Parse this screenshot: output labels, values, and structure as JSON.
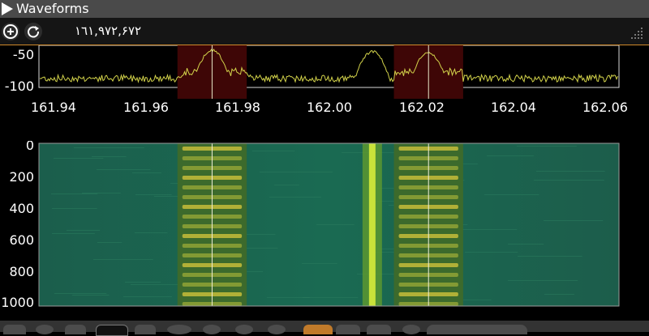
{
  "window": {
    "title": "Waveforms"
  },
  "toolbar": {
    "frequency": "١٦١,٩٧٢,۶٧٢",
    "zoom_in_icon": "zoom-in-icon",
    "redo_icon": "redo-icon"
  },
  "spectrum": {
    "y_tick_labels": [
      "-50",
      "-100"
    ],
    "x_tick_labels": [
      "161.94",
      "161.96",
      "161.98",
      "162.00",
      "162.02",
      "162.04",
      "162.06"
    ],
    "trace_color": "#d2d24a"
  },
  "waterfall": {
    "y_tick_labels": [
      "0",
      "200",
      "400",
      "600",
      "800",
      "1000"
    ]
  },
  "chart_data": {
    "type": "line",
    "x_range": [
      161.933,
      162.067
    ],
    "ylim": [
      -105,
      -45
    ],
    "markers": [
      161.973,
      162.023
    ],
    "highlight_bands": [
      [
        161.965,
        161.981
      ],
      [
        162.015,
        162.031
      ]
    ],
    "noise_floor": -92,
    "peaks": [
      {
        "x": 161.973,
        "y": -50
      },
      {
        "x": 162.01,
        "y": -52
      },
      {
        "x": 162.023,
        "y": -53
      }
    ],
    "waterfall_ylim": [
      0,
      1000
    ],
    "waterfall_ticks": [
      0,
      200,
      400,
      600,
      800,
      1000
    ]
  },
  "statusbar": {
    "icons": [
      "grid-icon",
      "circle-icon",
      "close-icon",
      "square-icon",
      "bluetooth-icon",
      "timer-icon",
      "circle-icon",
      "circle-icon",
      "info-icon",
      "marker-icon",
      "marker-icon",
      "marker-icon",
      "info-icon"
    ]
  }
}
